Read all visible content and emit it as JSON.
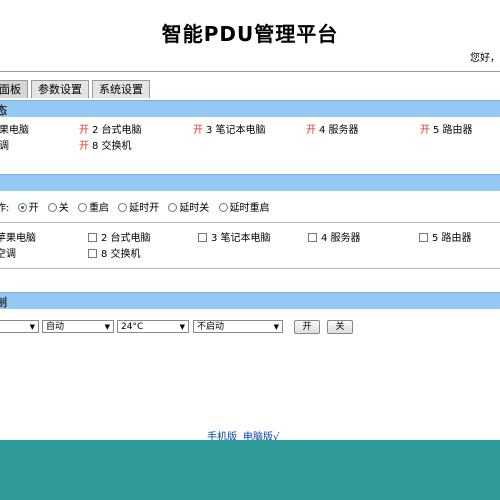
{
  "header": {
    "title": "智能PDU管理平台",
    "greeting": "您好，"
  },
  "tabs": [
    "面板",
    "参数设置",
    "系统设置"
  ],
  "sections": {
    "status": "态",
    "control": "",
    "aircon": "制"
  },
  "status_items": [
    {
      "on": "",
      "label": "果电脑"
    },
    {
      "on": "开",
      "label": "2 台式电脑"
    },
    {
      "on": "开",
      "label": "3 笔记本电脑"
    },
    {
      "on": "开",
      "label": "4 服务器"
    },
    {
      "on": "开",
      "label": "5 路由器"
    },
    {
      "on": "",
      "label": "调"
    },
    {
      "on": "开",
      "label": "8 交换机"
    }
  ],
  "control": {
    "label": "作:",
    "options": [
      "开",
      "关",
      "重启",
      "延时开",
      "延时关",
      "延时重启"
    ],
    "selected": "开"
  },
  "outlets": [
    "苹果电脑",
    "2 台式电脑",
    "3 笔记本电脑",
    "4 服务器",
    "5 路由器",
    "空调",
    "8 交换机"
  ],
  "aircon": {
    "selects": [
      "",
      "自动",
      "24°C",
      "不启动"
    ],
    "on_label": "开",
    "off_label": "关"
  },
  "footer": {
    "mobile": "手机版",
    "desktop": "电脑版√"
  },
  "colors": {
    "panel": "#95c8f5",
    "footer": "#2e9b9a",
    "on_text": "#e23a2a"
  }
}
